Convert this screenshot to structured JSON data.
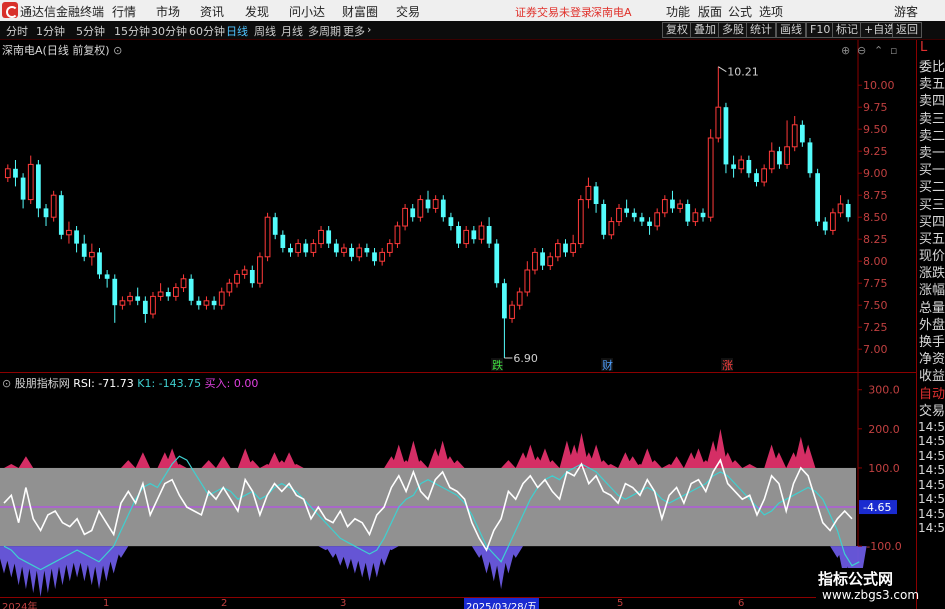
{
  "app": {
    "title": "通达信金融终端",
    "menu": [
      "行情",
      "市场",
      "资讯",
      "发现",
      "问小达",
      "财富圈",
      "交易"
    ],
    "status": "证券交易未登录",
    "stock_short": "深南电A",
    "right_menu": [
      "功能",
      "版面",
      "公式",
      "选项"
    ],
    "guest": "游客"
  },
  "toolbar": {
    "periods": [
      "分时",
      "1分钟",
      "5分钟",
      "15分钟",
      "30分钟",
      "60分钟",
      "日线",
      "周线",
      "月线",
      "多周期",
      "更多"
    ],
    "active_period": "日线",
    "buttons": [
      "复权",
      "叠加",
      "多股",
      "统计",
      "画线",
      "F10",
      "标记",
      "+自选",
      "返回"
    ]
  },
  "main_chart": {
    "title": "深南电A(日线 前复权)",
    "high_label": "10.21",
    "low_label": "6.90",
    "markers": [
      "跌",
      "财",
      "涨"
    ],
    "y_ticks": [
      "10.00",
      "9.75",
      "9.50",
      "9.25",
      "9.00",
      "8.75",
      "8.50",
      "8.25",
      "8.00",
      "7.75",
      "7.50",
      "7.25",
      "7.00"
    ],
    "colors": {
      "up": "#ff3a3a",
      "down": "#54fcfc",
      "grid": "#8b0000"
    }
  },
  "indicator": {
    "title": "股朋指标网",
    "rsi_label": "RSI: -71.73",
    "k1_label": "K1: -143.75",
    "buy_label": "买入: 0.00",
    "y_ticks": [
      "300.0",
      "200.0",
      "100.0",
      "-100.0"
    ],
    "cursor_value": "4.65",
    "colors": {
      "band": "#999999",
      "white_line": "#ffffff",
      "cyan_line": "#3fd0d0",
      "pink": "#e0306a",
      "blue": "#6a5ae0",
      "mid": "#c040ff"
    }
  },
  "x_axis": {
    "labels": [
      "2024年",
      "1",
      "2",
      "3",
      "2025/03/28/五",
      "5",
      "6"
    ]
  },
  "side_panel": {
    "top": "L",
    "items": [
      "委比",
      "卖五",
      "卖四",
      "卖三",
      "卖二",
      "卖一",
      "买一",
      "买二",
      "买三",
      "买四",
      "买五",
      "现价",
      "涨跌",
      "涨幅",
      "总量",
      "外盘",
      "换手",
      "净资",
      "收益"
    ],
    "auto_items": [
      "自动",
      "交易"
    ],
    "times": [
      "14:56",
      "14:56",
      "14:56",
      "14:56",
      "14:56",
      "14:56",
      "14:56",
      "14:56"
    ]
  },
  "watermark": {
    "title": "指标公式网",
    "url": "www.zbgs3.com"
  },
  "chart_data": {
    "type": "candlestick",
    "title": "深南电A(日线 前复权)",
    "ylim": [
      6.9,
      10.4
    ],
    "candles": [
      [
        8.95,
        9.05,
        8.9,
        9.1
      ],
      [
        9.05,
        8.95,
        8.85,
        9.15
      ],
      [
        8.95,
        8.7,
        8.6,
        9.0
      ],
      [
        8.7,
        9.1,
        8.65,
        9.2
      ],
      [
        9.1,
        8.6,
        8.5,
        9.15
      ],
      [
        8.6,
        8.5,
        8.4,
        8.65
      ],
      [
        8.5,
        8.75,
        8.45,
        8.8
      ],
      [
        8.75,
        8.3,
        8.25,
        8.8
      ],
      [
        8.3,
        8.35,
        8.2,
        8.45
      ],
      [
        8.35,
        8.2,
        8.1,
        8.4
      ],
      [
        8.2,
        8.05,
        8.0,
        8.3
      ],
      [
        8.05,
        8.1,
        7.95,
        8.2
      ],
      [
        8.1,
        7.85,
        7.8,
        8.15
      ],
      [
        7.85,
        7.8,
        7.7,
        7.9
      ],
      [
        7.8,
        7.5,
        7.3,
        7.85
      ],
      [
        7.5,
        7.55,
        7.45,
        7.6
      ],
      [
        7.55,
        7.6,
        7.5,
        7.65
      ],
      [
        7.6,
        7.55,
        7.5,
        7.7
      ],
      [
        7.55,
        7.4,
        7.3,
        7.6
      ],
      [
        7.4,
        7.6,
        7.35,
        7.65
      ],
      [
        7.6,
        7.65,
        7.55,
        7.75
      ],
      [
        7.65,
        7.6,
        7.55,
        7.7
      ],
      [
        7.6,
        7.7,
        7.55,
        7.75
      ],
      [
        7.7,
        7.8,
        7.65,
        7.85
      ],
      [
        7.8,
        7.55,
        7.5,
        7.85
      ],
      [
        7.55,
        7.5,
        7.45,
        7.6
      ],
      [
        7.5,
        7.55,
        7.45,
        7.6
      ],
      [
        7.55,
        7.5,
        7.45,
        7.6
      ],
      [
        7.5,
        7.65,
        7.45,
        7.7
      ],
      [
        7.65,
        7.75,
        7.6,
        7.8
      ],
      [
        7.75,
        7.85,
        7.7,
        7.9
      ],
      [
        7.85,
        7.9,
        7.8,
        7.95
      ],
      [
        7.9,
        7.75,
        7.7,
        7.95
      ],
      [
        7.75,
        8.05,
        7.7,
        8.1
      ],
      [
        8.05,
        8.5,
        8.0,
        8.55
      ],
      [
        8.5,
        8.3,
        8.25,
        8.55
      ],
      [
        8.3,
        8.15,
        8.1,
        8.35
      ],
      [
        8.15,
        8.1,
        8.05,
        8.2
      ],
      [
        8.1,
        8.2,
        8.05,
        8.25
      ],
      [
        8.2,
        8.1,
        8.05,
        8.25
      ],
      [
        8.1,
        8.2,
        8.05,
        8.25
      ],
      [
        8.2,
        8.35,
        8.15,
        8.4
      ],
      [
        8.35,
        8.2,
        8.15,
        8.4
      ],
      [
        8.2,
        8.1,
        8.05,
        8.25
      ],
      [
        8.1,
        8.15,
        8.05,
        8.2
      ],
      [
        8.15,
        8.05,
        8.0,
        8.2
      ],
      [
        8.05,
        8.15,
        8.0,
        8.2
      ],
      [
        8.15,
        8.1,
        8.05,
        8.2
      ],
      [
        8.1,
        8.0,
        7.95,
        8.15
      ],
      [
        8.0,
        8.1,
        7.95,
        8.15
      ],
      [
        8.1,
        8.2,
        8.05,
        8.25
      ],
      [
        8.2,
        8.4,
        8.15,
        8.45
      ],
      [
        8.4,
        8.6,
        8.35,
        8.65
      ],
      [
        8.6,
        8.5,
        8.45,
        8.65
      ],
      [
        8.5,
        8.7,
        8.45,
        8.75
      ],
      [
        8.7,
        8.6,
        8.55,
        8.8
      ],
      [
        8.6,
        8.7,
        8.55,
        8.75
      ],
      [
        8.7,
        8.5,
        8.45,
        8.75
      ],
      [
        8.5,
        8.4,
        8.35,
        8.55
      ],
      [
        8.4,
        8.2,
        8.15,
        8.45
      ],
      [
        8.2,
        8.35,
        8.15,
        8.4
      ],
      [
        8.35,
        8.25,
        8.2,
        8.4
      ],
      [
        8.25,
        8.4,
        8.2,
        8.45
      ],
      [
        8.4,
        8.2,
        8.15,
        8.5
      ],
      [
        8.2,
        7.75,
        7.7,
        8.25
      ],
      [
        7.75,
        7.35,
        6.9,
        7.8
      ],
      [
        7.35,
        7.5,
        7.3,
        7.55
      ],
      [
        7.5,
        7.65,
        7.45,
        7.7
      ],
      [
        7.65,
        7.9,
        7.6,
        8.0
      ],
      [
        7.9,
        8.1,
        7.85,
        8.15
      ],
      [
        8.1,
        7.95,
        7.9,
        8.15
      ],
      [
        7.95,
        8.05,
        7.9,
        8.1
      ],
      [
        8.05,
        8.2,
        8.0,
        8.25
      ],
      [
        8.2,
        8.1,
        8.05,
        8.25
      ],
      [
        8.1,
        8.2,
        8.05,
        8.3
      ],
      [
        8.2,
        8.7,
        8.15,
        8.75
      ],
      [
        8.7,
        8.85,
        8.6,
        8.95
      ],
      [
        8.85,
        8.65,
        8.55,
        8.9
      ],
      [
        8.65,
        8.3,
        8.25,
        8.7
      ],
      [
        8.3,
        8.45,
        8.25,
        8.5
      ],
      [
        8.45,
        8.6,
        8.4,
        8.65
      ],
      [
        8.6,
        8.55,
        8.5,
        8.7
      ],
      [
        8.55,
        8.5,
        8.45,
        8.6
      ],
      [
        8.5,
        8.45,
        8.4,
        8.55
      ],
      [
        8.45,
        8.4,
        8.3,
        8.5
      ],
      [
        8.4,
        8.55,
        8.35,
        8.6
      ],
      [
        8.55,
        8.7,
        8.5,
        8.75
      ],
      [
        8.7,
        8.6,
        8.55,
        8.8
      ],
      [
        8.6,
        8.65,
        8.55,
        8.7
      ],
      [
        8.65,
        8.45,
        8.4,
        8.7
      ],
      [
        8.45,
        8.55,
        8.4,
        8.6
      ],
      [
        8.55,
        8.5,
        8.45,
        8.6
      ],
      [
        8.5,
        9.4,
        8.45,
        9.5
      ],
      [
        9.4,
        9.75,
        9.35,
        10.21
      ],
      [
        9.75,
        9.1,
        9.0,
        9.8
      ],
      [
        9.1,
        9.05,
        8.95,
        9.2
      ],
      [
        9.05,
        9.15,
        9.0,
        9.2
      ],
      [
        9.15,
        9.0,
        8.95,
        9.2
      ],
      [
        9.0,
        8.9,
        8.85,
        9.05
      ],
      [
        8.9,
        9.05,
        8.85,
        9.1
      ],
      [
        9.05,
        9.25,
        9.0,
        9.35
      ],
      [
        9.25,
        9.1,
        9.05,
        9.3
      ],
      [
        9.1,
        9.3,
        9.05,
        9.6
      ],
      [
        9.3,
        9.55,
        9.25,
        9.65
      ],
      [
        9.55,
        9.35,
        9.3,
        9.6
      ],
      [
        9.35,
        9.0,
        8.95,
        9.4
      ],
      [
        9.0,
        8.45,
        8.4,
        9.05
      ],
      [
        8.45,
        8.35,
        8.3,
        8.5
      ],
      [
        8.35,
        8.55,
        8.3,
        8.6
      ],
      [
        8.55,
        8.65,
        8.5,
        8.75
      ],
      [
        8.65,
        8.5,
        8.45,
        8.7
      ]
    ],
    "indicator": {
      "ylim": [
        -230,
        330
      ],
      "rsi_white": [
        10,
        30,
        -40,
        50,
        -30,
        -60,
        -20,
        -10,
        -40,
        -50,
        -30,
        -70,
        -60,
        -10,
        -40,
        -70,
        10,
        40,
        10,
        60,
        -20,
        20,
        60,
        70,
        30,
        0,
        -10,
        -20,
        40,
        20,
        50,
        20,
        -10,
        70,
        40,
        -20,
        30,
        60,
        40,
        60,
        30,
        20,
        -30,
        0,
        -30,
        -40,
        -10,
        -50,
        -30,
        -40,
        -70,
        -20,
        0,
        50,
        80,
        40,
        90,
        40,
        20,
        70,
        90,
        50,
        40,
        20,
        -40,
        -80,
        -110,
        -60,
        -30,
        40,
        20,
        60,
        80,
        50,
        70,
        40,
        20,
        90,
        80,
        110,
        60,
        80,
        40,
        30,
        10,
        60,
        50,
        30,
        70,
        40,
        -30,
        30,
        50,
        10,
        60,
        70,
        40,
        90,
        120,
        60,
        40,
        20,
        30,
        -20,
        20,
        80,
        60,
        -10,
        60,
        100,
        80,
        20,
        -40,
        -60,
        -30,
        -10,
        -30
      ],
      "k1_cyan": [
        -100,
        -110,
        -130,
        -140,
        -150,
        -160,
        -150,
        -140,
        -130,
        -120,
        -110,
        -120,
        -130,
        -140,
        -120,
        -100,
        -60,
        -20,
        20,
        50,
        60,
        50,
        80,
        110,
        130,
        120,
        90,
        60,
        30,
        40,
        50,
        40,
        20,
        30,
        40,
        20,
        30,
        50,
        60,
        50,
        40,
        20,
        0,
        -20,
        -40,
        -60,
        -80,
        -90,
        -100,
        -110,
        -120,
        -110,
        -80,
        -40,
        0,
        20,
        30,
        60,
        70,
        60,
        50,
        40,
        30,
        10,
        -20,
        -60,
        -100,
        -120,
        -140,
        -100,
        -60,
        -20,
        20,
        50,
        70,
        80,
        70,
        90,
        100,
        110,
        100,
        90,
        70,
        50,
        30,
        20,
        30,
        40,
        50,
        40,
        20,
        10,
        20,
        30,
        40,
        50,
        60,
        80,
        90,
        80,
        60,
        40,
        20,
        0,
        -20,
        -10,
        10,
        20,
        30,
        40,
        50,
        40,
        20,
        -20,
        -60,
        -120,
        -150,
        -140
      ]
    }
  }
}
